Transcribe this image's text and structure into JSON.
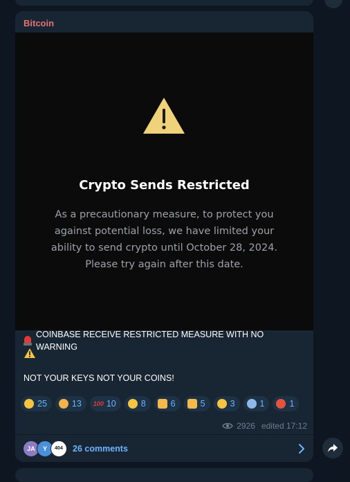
{
  "channel": {
    "name": "Bitcoin"
  },
  "media": {
    "title": "Crypto Sends Restricted",
    "body_lines": [
      "As a precautionary measure, to protect you",
      "against potential loss, we have limited your",
      "ability to send crypto until October 28, 2024.",
      "Please try again after this date."
    ],
    "icon": "warning-triangle-icon"
  },
  "message": {
    "line1": "COINBASE RECEIVE RESTRICTED MEASURE WITH NO WARNING",
    "line3": "NOT YOUR KEYS NOT YOUR COINS!",
    "line1_icon": "police-siren-icon",
    "line2_icon": "warning-icon"
  },
  "reactions": [
    {
      "icon": "crying-face-icon",
      "count": "25",
      "color": "#f6c343"
    },
    {
      "icon": "cowboy-face-icon",
      "count": "13",
      "color": "#f3b24a"
    },
    {
      "icon": "hundred-points-icon",
      "count": "10",
      "color": "#e53935"
    },
    {
      "icon": "grimacing-face-icon",
      "count": "8",
      "color": "#f6c343"
    },
    {
      "icon": "thumbs-up-icon",
      "count": "6",
      "color": "#f4b94a"
    },
    {
      "icon": "thumbs-down-icon",
      "count": "5",
      "color": "#f4b94a"
    },
    {
      "icon": "confused-face-icon",
      "count": "3",
      "color": "#f6c343"
    },
    {
      "icon": "screaming-face-icon",
      "count": "1",
      "color": "#8fb8e8"
    },
    {
      "icon": "angry-cursing-face-icon",
      "count": "1",
      "color": "#e5533d"
    }
  ],
  "meta": {
    "views": "2926",
    "edited": "edited 17:12",
    "views_icon": "eye-icon"
  },
  "comments": {
    "label": "26 comments",
    "avatars": [
      {
        "initials": "JA",
        "color": "#8e7cc3"
      },
      {
        "initials": "Y",
        "color": "#4a90d9"
      },
      {
        "initials": "404",
        "color": "#ffffff"
      }
    ]
  },
  "colors": {
    "background": "#0e1621",
    "bubble": "#182533",
    "channel_name": "#e57373",
    "accent": "#6fb3ff",
    "warning_yellow": "#f0d27a"
  }
}
